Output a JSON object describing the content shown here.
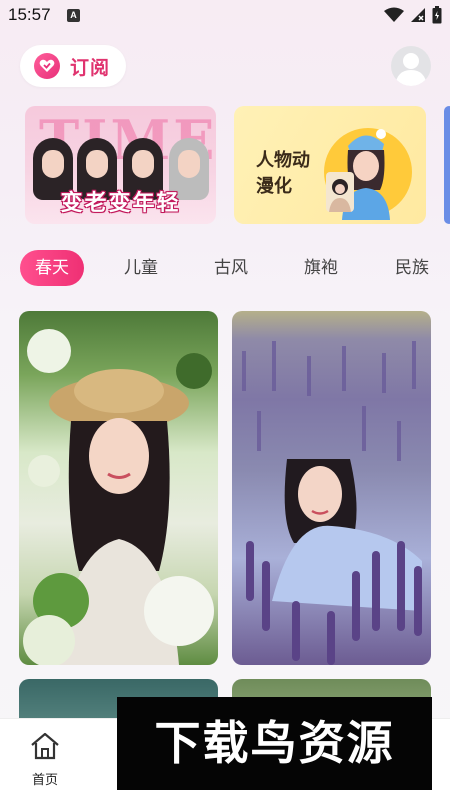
{
  "status_bar": {
    "time": "15:57",
    "notification_icon": "A"
  },
  "header": {
    "subscribe_label": "订阅"
  },
  "banners": [
    {
      "overlay_text": "TIME",
      "title": "变老变年轻"
    },
    {
      "title": "人物动漫化"
    }
  ],
  "tabs": [
    {
      "label": "春天",
      "active": true
    },
    {
      "label": "儿童",
      "active": false
    },
    {
      "label": "古风",
      "active": false
    },
    {
      "label": "旗袍",
      "active": false
    },
    {
      "label": "民族",
      "active": false
    }
  ],
  "bottom_nav": {
    "home_label": "首页"
  },
  "watermark": "下载鸟资源",
  "colors": {
    "accent": "#ef3074",
    "subscribe_text": "#e0336f"
  }
}
